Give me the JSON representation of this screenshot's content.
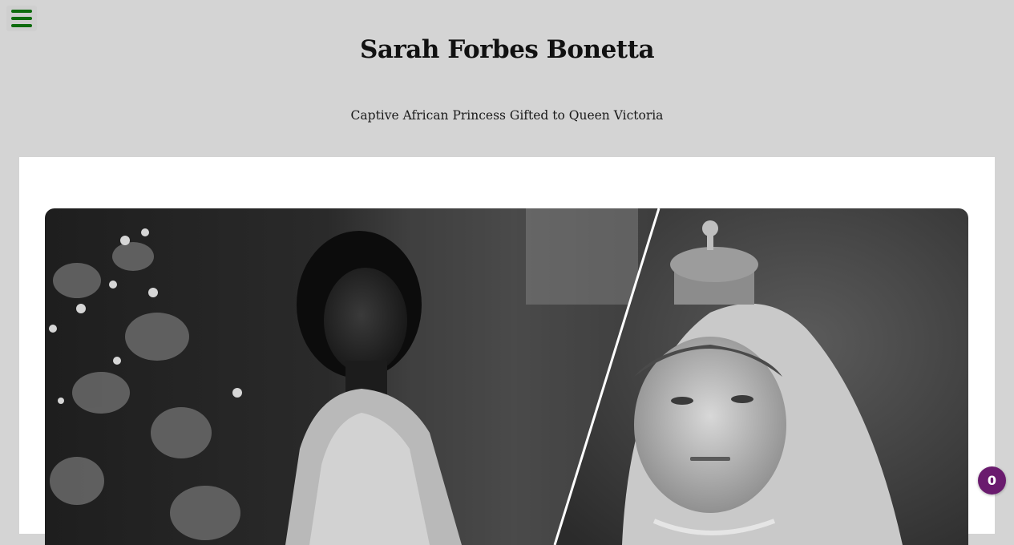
{
  "header": {
    "menu_icon": "hamburger-menu-icon",
    "menu_color": "#0e6b0e",
    "title": "Sarah Forbes Bonetta",
    "subtitle": "Captive African Princess Gifted to Queen Victoria"
  },
  "hero_image": {
    "panels": [
      "Sarah Forbes Bonetta portrait",
      "Queen Victoria portrait"
    ],
    "style": "black-and-white photographs, diagonal split"
  },
  "badge": {
    "count": "0",
    "color": "#6a1b6e"
  },
  "colors": {
    "page_background": "#d4d4d4",
    "card_background": "#ffffff"
  }
}
